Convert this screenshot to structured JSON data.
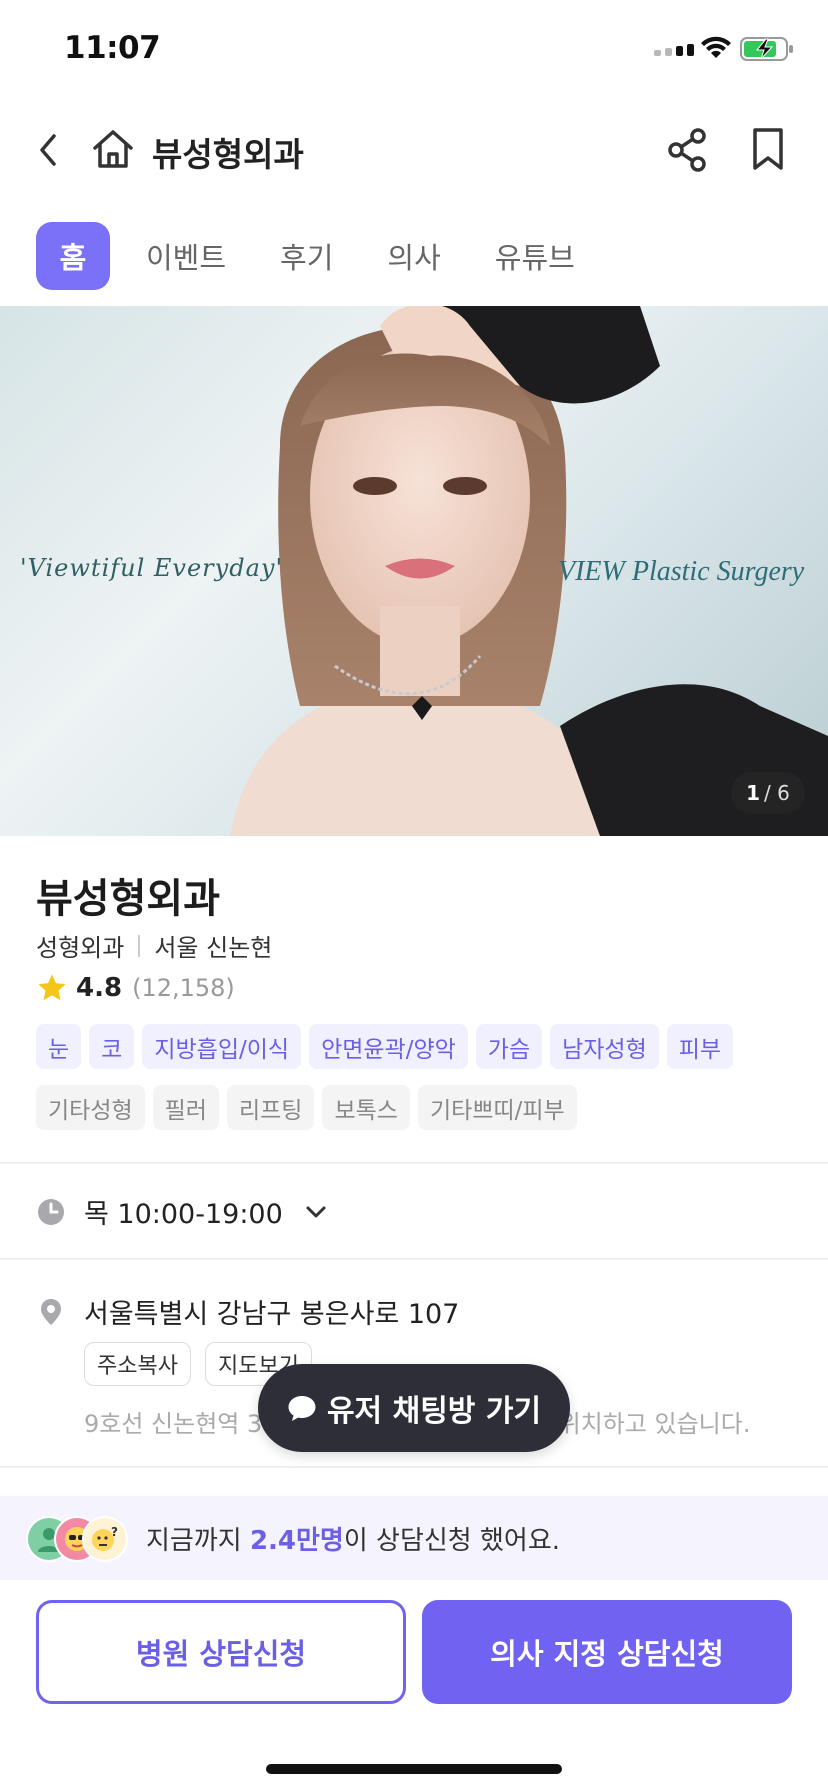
{
  "status_bar": {
    "time": "11:07"
  },
  "header": {
    "title": "뷰성형외과"
  },
  "tabs": [
    {
      "label": "홈",
      "active": true
    },
    {
      "label": "이벤트",
      "active": false
    },
    {
      "label": "후기",
      "active": false
    },
    {
      "label": "의사",
      "active": false
    },
    {
      "label": "유튜브",
      "active": false
    }
  ],
  "hero": {
    "text_left": "'Viewtiful Everyday'",
    "text_right": "VIEW Plastic Surgery",
    "counter_current": "1",
    "counter_total": "/ 6"
  },
  "clinic": {
    "name": "뷰성형외과",
    "category": "성형외과",
    "location": "서울 신논현",
    "rating": "4.8",
    "review_count": "(12,158)"
  },
  "tags_primary": [
    "눈",
    "코",
    "지방흡입/이식",
    "안면윤곽/양악",
    "가슴",
    "남자성형",
    "피부"
  ],
  "tags_secondary": [
    "기타성형",
    "필러",
    "리프팅",
    "보톡스",
    "기타쁘띠/피부"
  ],
  "hours": {
    "text": "목 10:00-19:00"
  },
  "address": {
    "text": "서울특별시 강남구 봉은사로 107",
    "copy_label": "주소복사",
    "map_label": "지도보기",
    "directions": "9호선 신논현역 3번 출구에서 도보 1분 거리에 위치하고 있습니다."
  },
  "chat_pill": {
    "label": "유저 채팅방 가기"
  },
  "banner": {
    "prefix": "지금까지 ",
    "highlight": "2.4만명",
    "suffix": "이 상담신청 했어요."
  },
  "cta": {
    "hospital": "병원 상담신청",
    "doctor": "의사 지정 상담신청"
  },
  "colors": {
    "accent": "#7163f2",
    "tag_text": "#6b5fe6",
    "star": "#f5c518"
  }
}
